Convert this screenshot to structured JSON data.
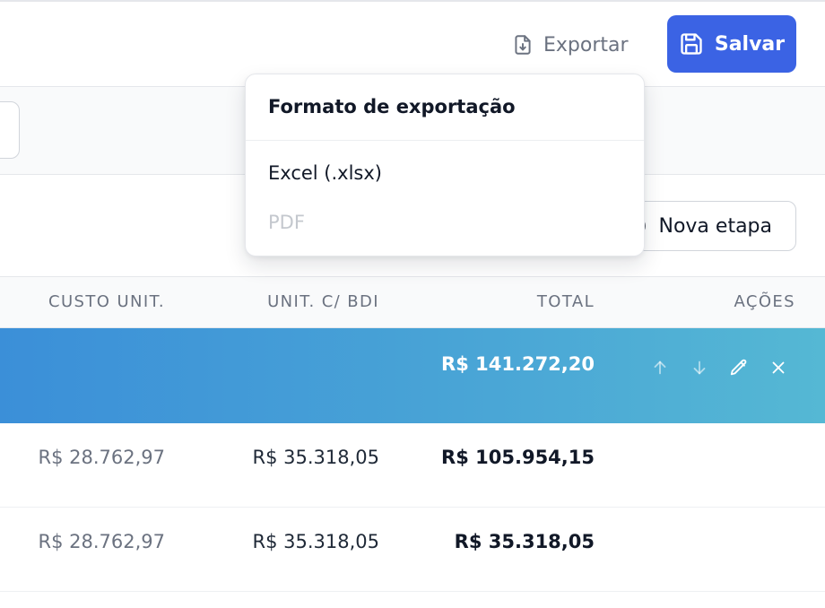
{
  "header": {
    "export_label": "Exportar",
    "save_label": "Salvar",
    "accent_color": "#3b63e4"
  },
  "toolbar": {
    "nova_etapa_label": "Nova etapa",
    "nova_etapa_prefix": ")"
  },
  "table": {
    "columns": [
      "CUSTO UNIT.",
      "UNIT. C/ BDI",
      "TOTAL",
      "AÇÕES"
    ],
    "stage": {
      "total": "R$ 141.272,20",
      "actions": [
        "arrow-up-icon",
        "arrow-down-icon",
        "pencil-icon",
        "close-icon"
      ]
    },
    "rows": [
      {
        "custo_unit": "R$ 28.762,97",
        "unit_bdi": "R$ 35.318,05",
        "total": "R$ 105.954,15"
      },
      {
        "custo_unit": "R$ 28.762,97",
        "unit_bdi": "R$ 35.318,05",
        "total": "R$ 35.318,05"
      }
    ]
  },
  "export_menu": {
    "title": "Formato de exportação",
    "options": [
      {
        "label": "Excel (.xlsx)",
        "enabled": true
      },
      {
        "label": "PDF",
        "enabled": false
      }
    ]
  }
}
